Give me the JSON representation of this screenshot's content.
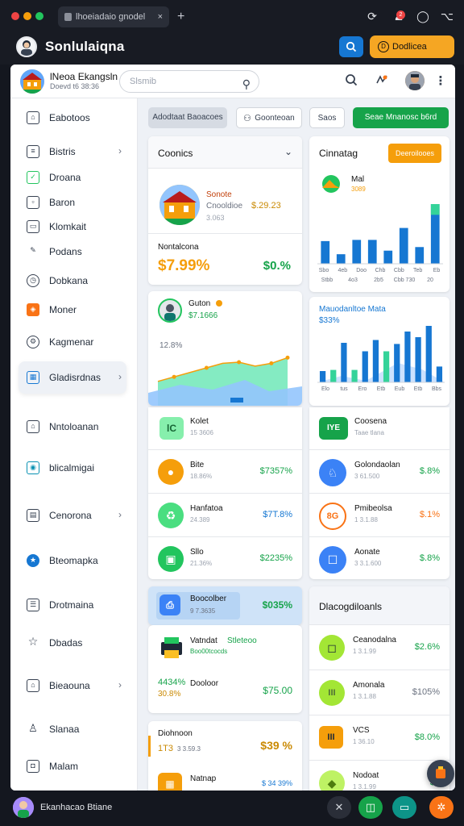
{
  "browser": {
    "tab_title": "lhoeiadaio gnodel",
    "tab_close": "×",
    "new_tab": "+",
    "notification_count": "2"
  },
  "app": {
    "title": "Sonlulaiqna",
    "promo_label": "Dodlicea",
    "promo_icon": "D"
  },
  "workspace": {
    "name": "lNeoa Ekangsln",
    "subtitle": "Doevd t6 38:36",
    "search_placeholder": "Slsmib"
  },
  "sidebar": {
    "items": [
      {
        "label": "Eabotoos",
        "icon": "home-icon"
      },
      {
        "label": "Bistris",
        "icon": "list-icon",
        "chevron": "›"
      },
      {
        "label": "Droana",
        "icon": "check-icon"
      },
      {
        "label": "Baron",
        "icon": "image-icon"
      },
      {
        "label": "Klomkait",
        "icon": "calendar-icon"
      },
      {
        "label": "Podans",
        "icon": "pen-icon"
      },
      {
        "label": "Dobkana",
        "icon": "clock-icon"
      },
      {
        "label": "Moner",
        "icon": "tag-icon"
      },
      {
        "label": "Kagmenar",
        "icon": "gear-icon"
      },
      {
        "label": "Gladisrdnas",
        "icon": "grid-icon",
        "chevron": "›",
        "active": true
      },
      {
        "label": "Nntoloanan",
        "icon": "bookmark-icon"
      },
      {
        "label": "blicalmigai",
        "icon": "camera-icon"
      },
      {
        "label": "Cenorona",
        "icon": "chart-icon",
        "chevron": "›"
      },
      {
        "label": "Bteomapka",
        "icon": "star-icon"
      },
      {
        "label": "Drotmaina",
        "icon": "doc-icon"
      },
      {
        "label": "Dbadas",
        "icon": "star-outline-icon"
      },
      {
        "label": "Bieaouna",
        "icon": "home-icon",
        "chevron": "›"
      },
      {
        "label": "Slanaa",
        "icon": "user-icon"
      },
      {
        "label": "Malam",
        "icon": "lock-icon"
      }
    ]
  },
  "toolbar": {
    "filter_label": "Adodtaat Baoacoes",
    "search_label": "Goonteoan",
    "small_label": "Saos",
    "primary_label": "Seae Mnanosc b6rd"
  },
  "card_overview": {
    "title": "Coonics",
    "feature_title": "Sonote",
    "feature_line": "Cnooldioe",
    "feature_amount": "$.29.23",
    "feature_sub": "3.063",
    "label": "Nontalcona",
    "big_value": "$7.99%",
    "pct": "$0.%"
  },
  "card_chart1": {
    "title": "Cinnatag",
    "badge": "Deeroilooes",
    "legend_label": "Mal",
    "legend_sub": "3089",
    "axis_labels": [
      "Sbo",
      "4eb",
      "Doo",
      "Chb",
      "Cbb",
      "Teb",
      "Eb"
    ],
    "colors": {
      "bar": "#1677d2",
      "highlight": "#34d399"
    }
  },
  "chart_data": [
    {
      "type": "bar",
      "categories": [
        "Sbo",
        "4eb",
        "Doo",
        "Chb",
        "Cbb",
        "Teb",
        "Eb"
      ],
      "values": [
        38,
        16,
        40,
        40,
        22,
        60,
        28,
        100
      ],
      "ylim": [
        0,
        100
      ]
    },
    {
      "type": "area",
      "title": "Guton",
      "subtitle": "$7.1666",
      "ylabel": "12.8%",
      "x": [
        0,
        1,
        2,
        3,
        4,
        5,
        6,
        7,
        8
      ],
      "values": [
        26,
        34,
        42,
        50,
        58,
        60,
        53,
        58,
        68
      ],
      "ylim": [
        0,
        100
      ]
    },
    {
      "type": "bar",
      "title": "Mauodanltoe Mata",
      "subtitle": "$33%",
      "categories": [
        "Elo",
        "tus",
        "Ero",
        "Etb",
        "Eub",
        "Etb",
        "Bbs"
      ],
      "values": [
        20,
        22,
        70,
        22,
        55,
        75,
        55,
        68,
        90,
        80,
        100,
        28
      ],
      "ylim": [
        0,
        100
      ]
    }
  ],
  "metric_rows_left": [
    {
      "label": "Kolet",
      "sub": "15 3606",
      "value": "",
      "icon_text": "lC",
      "color": "#22c55e"
    },
    {
      "label": "Bite",
      "sub": "18.86%",
      "value": "$7357%",
      "icon_text": "●",
      "color": "#f59e0b"
    },
    {
      "label": "Hanfatoa",
      "sub": "24.389",
      "value": "$7T.8%",
      "icon_text": "♻",
      "color": "#22c55e"
    },
    {
      "label": "Sllo",
      "sub": "21.36%",
      "value": "$2235%",
      "icon_text": "▣",
      "color": "#22c55e"
    }
  ],
  "metric_rows_right": [
    {
      "label": "Coosena",
      "sub": "Taae tlana",
      "value": "",
      "icon_text": "IYE",
      "color": "#22c55e"
    },
    {
      "label": "Golondaolan",
      "sub": "3 61.500",
      "value": "$.8%",
      "icon_text": "♘",
      "color": "#3b82f6"
    },
    {
      "label": "Pmibeolsa",
      "sub": "1 3.1.88",
      "value": "$.1%",
      "icon_text": "8G",
      "color": "#f97316"
    },
    {
      "label": "Aonate",
      "sub": "3 3.1.600",
      "value": "$.8%",
      "icon_text": "☐",
      "color": "#3b82f6"
    }
  ],
  "card_highlight": {
    "label": "Boocolber",
    "sub": "9 7.3635",
    "value": "$035%"
  },
  "card_products": {
    "title": "Vatndat",
    "tag": "Stleteoo",
    "sub": "Boo00tcocds",
    "row_pct": "4434%",
    "row_pct2": "30.8%",
    "row_label": "Dooloor",
    "row_value": "$75.00"
  },
  "card_bottom_left": {
    "label": "Diohnoon",
    "sub_a": "1T3",
    "sub_b": "3 3.59.3",
    "value": "$39 %",
    "label2": "Natnap",
    "value2": "$ 34 39%"
  },
  "card_categories": {
    "title": "Dlacogdiloanls",
    "rows": [
      {
        "label": "Ceanodalna",
        "sub": "1 3.1.99",
        "value": "$2.6%",
        "icon_text": "◻",
        "color": "#84cc16"
      },
      {
        "label": "Amonala",
        "sub": "1 3.1.88",
        "value": "$105%",
        "icon_text": "III",
        "color": "#84cc16"
      },
      {
        "label": "VCS",
        "sub": "1 36.10",
        "value": "$8.0%",
        "icon_text": "III",
        "color": "#f59e0b"
      },
      {
        "label": "Nodoat",
        "sub": "1 3.1.99",
        "value": "$3",
        "icon_text": "◆",
        "color": "#84cc16"
      }
    ]
  },
  "taskbar": {
    "user_name": "Ekanhacao Btiane"
  }
}
